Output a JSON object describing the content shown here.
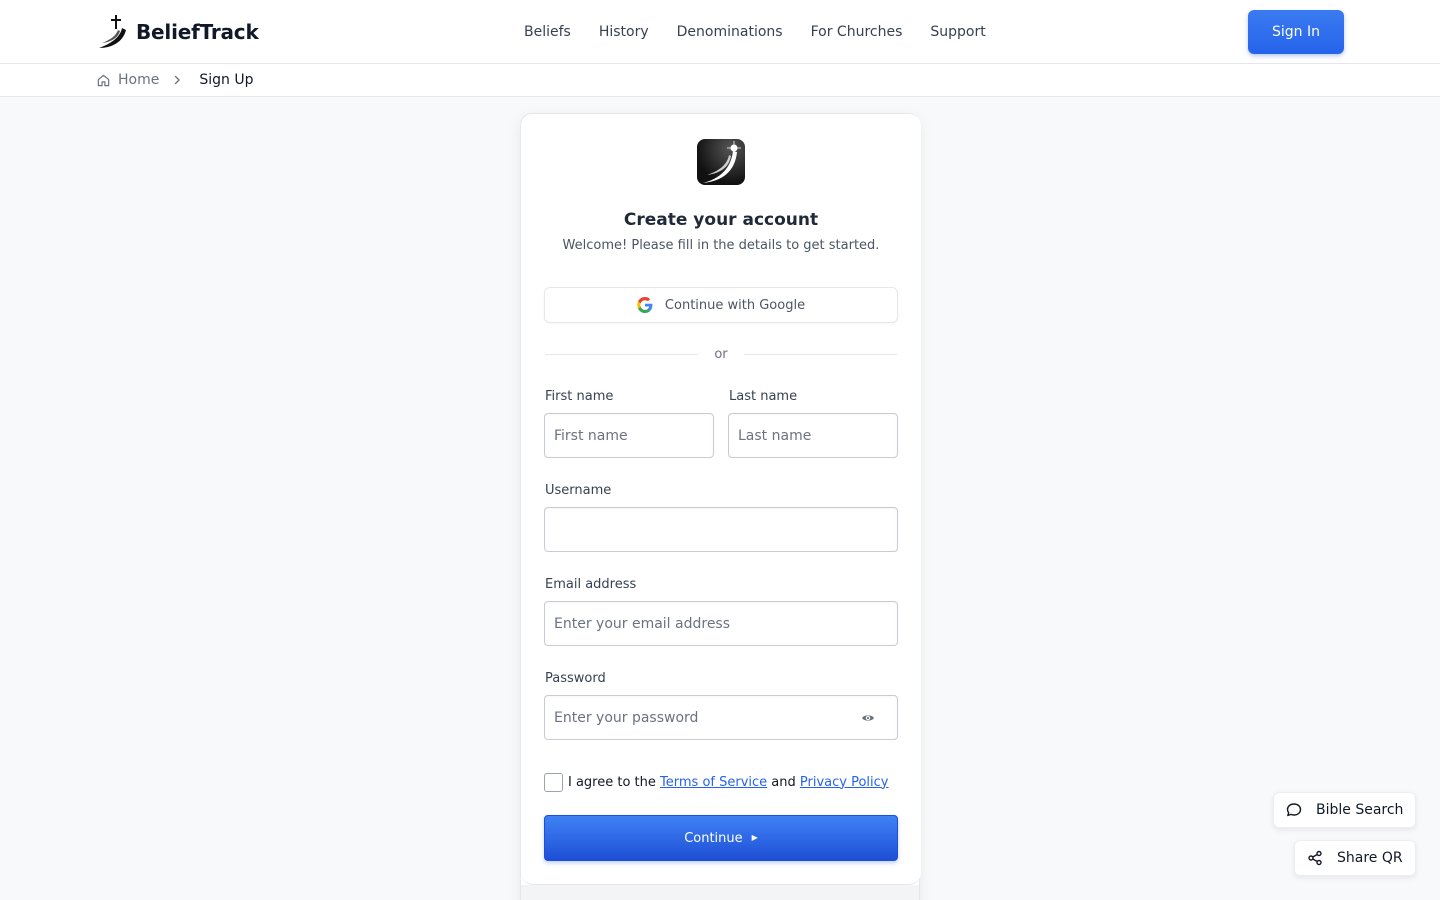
{
  "header": {
    "brand_name": "BeliefTrack",
    "nav": [
      "Beliefs",
      "History",
      "Denominations",
      "For Churches",
      "Support"
    ],
    "signin_label": "Sign In"
  },
  "breadcrumb": {
    "home": "Home",
    "current": "Sign Up"
  },
  "card": {
    "title": "Create your account",
    "subtitle": "Welcome! Please fill in the details to get started.",
    "google_label": "Continue with Google",
    "divider_text": "or",
    "first_name_label": "First name",
    "first_name_placeholder": "First name",
    "last_name_label": "Last name",
    "last_name_placeholder": "Last name",
    "username_label": "Username",
    "username_value": "",
    "email_label": "Email address",
    "email_placeholder": "Enter your email address",
    "password_label": "Password",
    "password_placeholder": "Enter your password",
    "agree_prefix": "I agree to the",
    "terms_link": "Terms of Service",
    "agree_and": "and",
    "privacy_link": "Privacy Policy",
    "continue_label": "Continue"
  },
  "floating": {
    "bible_search": "Bible Search",
    "share_qr": "Share QR"
  },
  "icons": {
    "brand": "cross-road-logo-icon",
    "home": "home-icon",
    "breadcrumb_separator": "chevron-right-icon",
    "google": "google-icon",
    "password_toggle": "eye-icon",
    "bible_search": "chat-bubble-icon",
    "share_qr": "share-icon"
  },
  "colors": {
    "accent": "#2563eb",
    "page_background": "#f8f9fb",
    "link": "#2563eb"
  }
}
